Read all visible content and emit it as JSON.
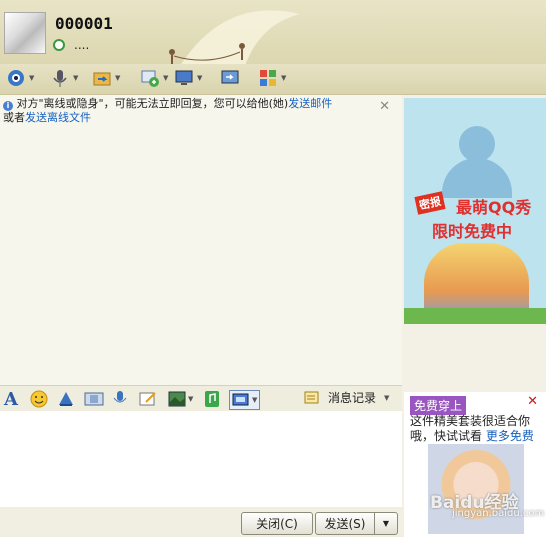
{
  "header": {
    "username": "000001",
    "signature": "...."
  },
  "toolbar": {
    "icons": [
      "video-call-icon",
      "voice-call-icon",
      "send-file-icon",
      "group-chat-icon",
      "remote-assist-icon",
      "share-screen-icon",
      "apps-icon"
    ]
  },
  "notice": {
    "text_before": "对方\"离线或隐身\"，可能无法立即回复，您可以给他(她)",
    "link_email": "发送邮件",
    "text_middle": "或者",
    "link_offline_file": "发送离线文件"
  },
  "ad": {
    "tag": "密报",
    "line1": "最萌QQ秀",
    "line2": "限时免费中"
  },
  "input_toolbar": {
    "history_label": "消息记录"
  },
  "buttons": {
    "close": "关闭(C)",
    "send": "发送(S)"
  },
  "side_panel": {
    "badge": "免费穿上",
    "text": "这件精美套装很适合你哦，快试试看",
    "link": "更多免费"
  },
  "watermark": {
    "main": "Baidu经验",
    "sub": "jingyan.baidu.com"
  },
  "colors": {
    "link": "#1560c0",
    "accent_red": "#e03030",
    "header_bg": "#dcd7b0"
  }
}
